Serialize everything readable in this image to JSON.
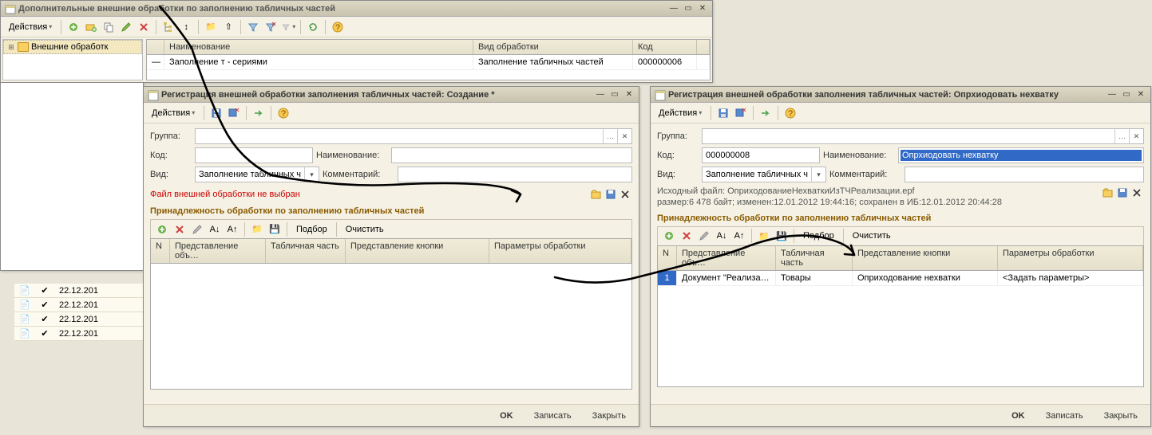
{
  "main_window": {
    "title": "Дополнительные внешние обработки по заполнению табличных частей",
    "actions_label": "Действия",
    "tree_root": "Внешние обработк",
    "grid": {
      "col_name": "Наименование",
      "col_type": "Вид обработки",
      "col_code": "Код",
      "row": {
        "name": "Заполнение т - сериями",
        "type": "Заполнение табличных частей",
        "code": "000000006"
      }
    }
  },
  "bg_list": {
    "dates": [
      "22.12.201",
      "22.12.201",
      "22.12.201",
      "22.12.201"
    ]
  },
  "dlg_left": {
    "title": "Регистрация внешней обработки заполнения табличных частей: Создание *",
    "actions_label": "Действия",
    "labels": {
      "group": "Группа:",
      "code": "Код:",
      "name": "Наименование:",
      "kind": "Вид:",
      "comment": "Комментарий:"
    },
    "values": {
      "group": "",
      "code": "",
      "name": "",
      "kind": "Заполнение табличных ч",
      "comment": ""
    },
    "warning": "Файл внешней обработки не выбран",
    "section": "Принадлежность обработки по заполнению табличных частей",
    "toolbar": {
      "pick": "Подбор",
      "clear": "Очистить"
    },
    "grid_cols": {
      "n": "N",
      "obj": "Представление объ…",
      "tab": "Табличная часть",
      "btn": "Представление кнопки",
      "params": "Параметры обработки"
    },
    "footer": {
      "ok": "OK",
      "write": "Записать",
      "close": "Закрыть"
    }
  },
  "dlg_right": {
    "title": "Регистрация внешней обработки заполнения табличных частей: Опрхиодовать нехватку",
    "actions_label": "Действия",
    "labels": {
      "group": "Группа:",
      "code": "Код:",
      "name": "Наименование:",
      "kind": "Вид:",
      "comment": "Комментарий:"
    },
    "values": {
      "group": "",
      "code": "000000008",
      "name": "Опрхиодовать нехватку",
      "kind": "Заполнение табличных ч",
      "comment": ""
    },
    "file_info_1": "Исходный файл: ОприходованиеНехваткиИзТЧРеализации.epf",
    "file_info_2": "размер:6 478 байт; изменен:12.01.2012 19:44:16; сохранен в ИБ:12.01.2012 20:44:28",
    "section": "Принадлежность обработки по заполнению табличных частей",
    "toolbar": {
      "pick": "Подбор",
      "clear": "Очистить"
    },
    "grid_cols": {
      "n": "N",
      "obj": "Представление объ…",
      "tab": "Табличная часть",
      "btn": "Представление кнопки",
      "params": "Параметры обработки"
    },
    "grid_row": {
      "n": "1",
      "obj": "Документ \"Реализа…",
      "tab": "Товары",
      "btn": "Оприходование нехватки",
      "params": "<Задать параметры>"
    },
    "footer": {
      "ok": "OK",
      "write": "Записать",
      "close": "Закрыть"
    }
  }
}
